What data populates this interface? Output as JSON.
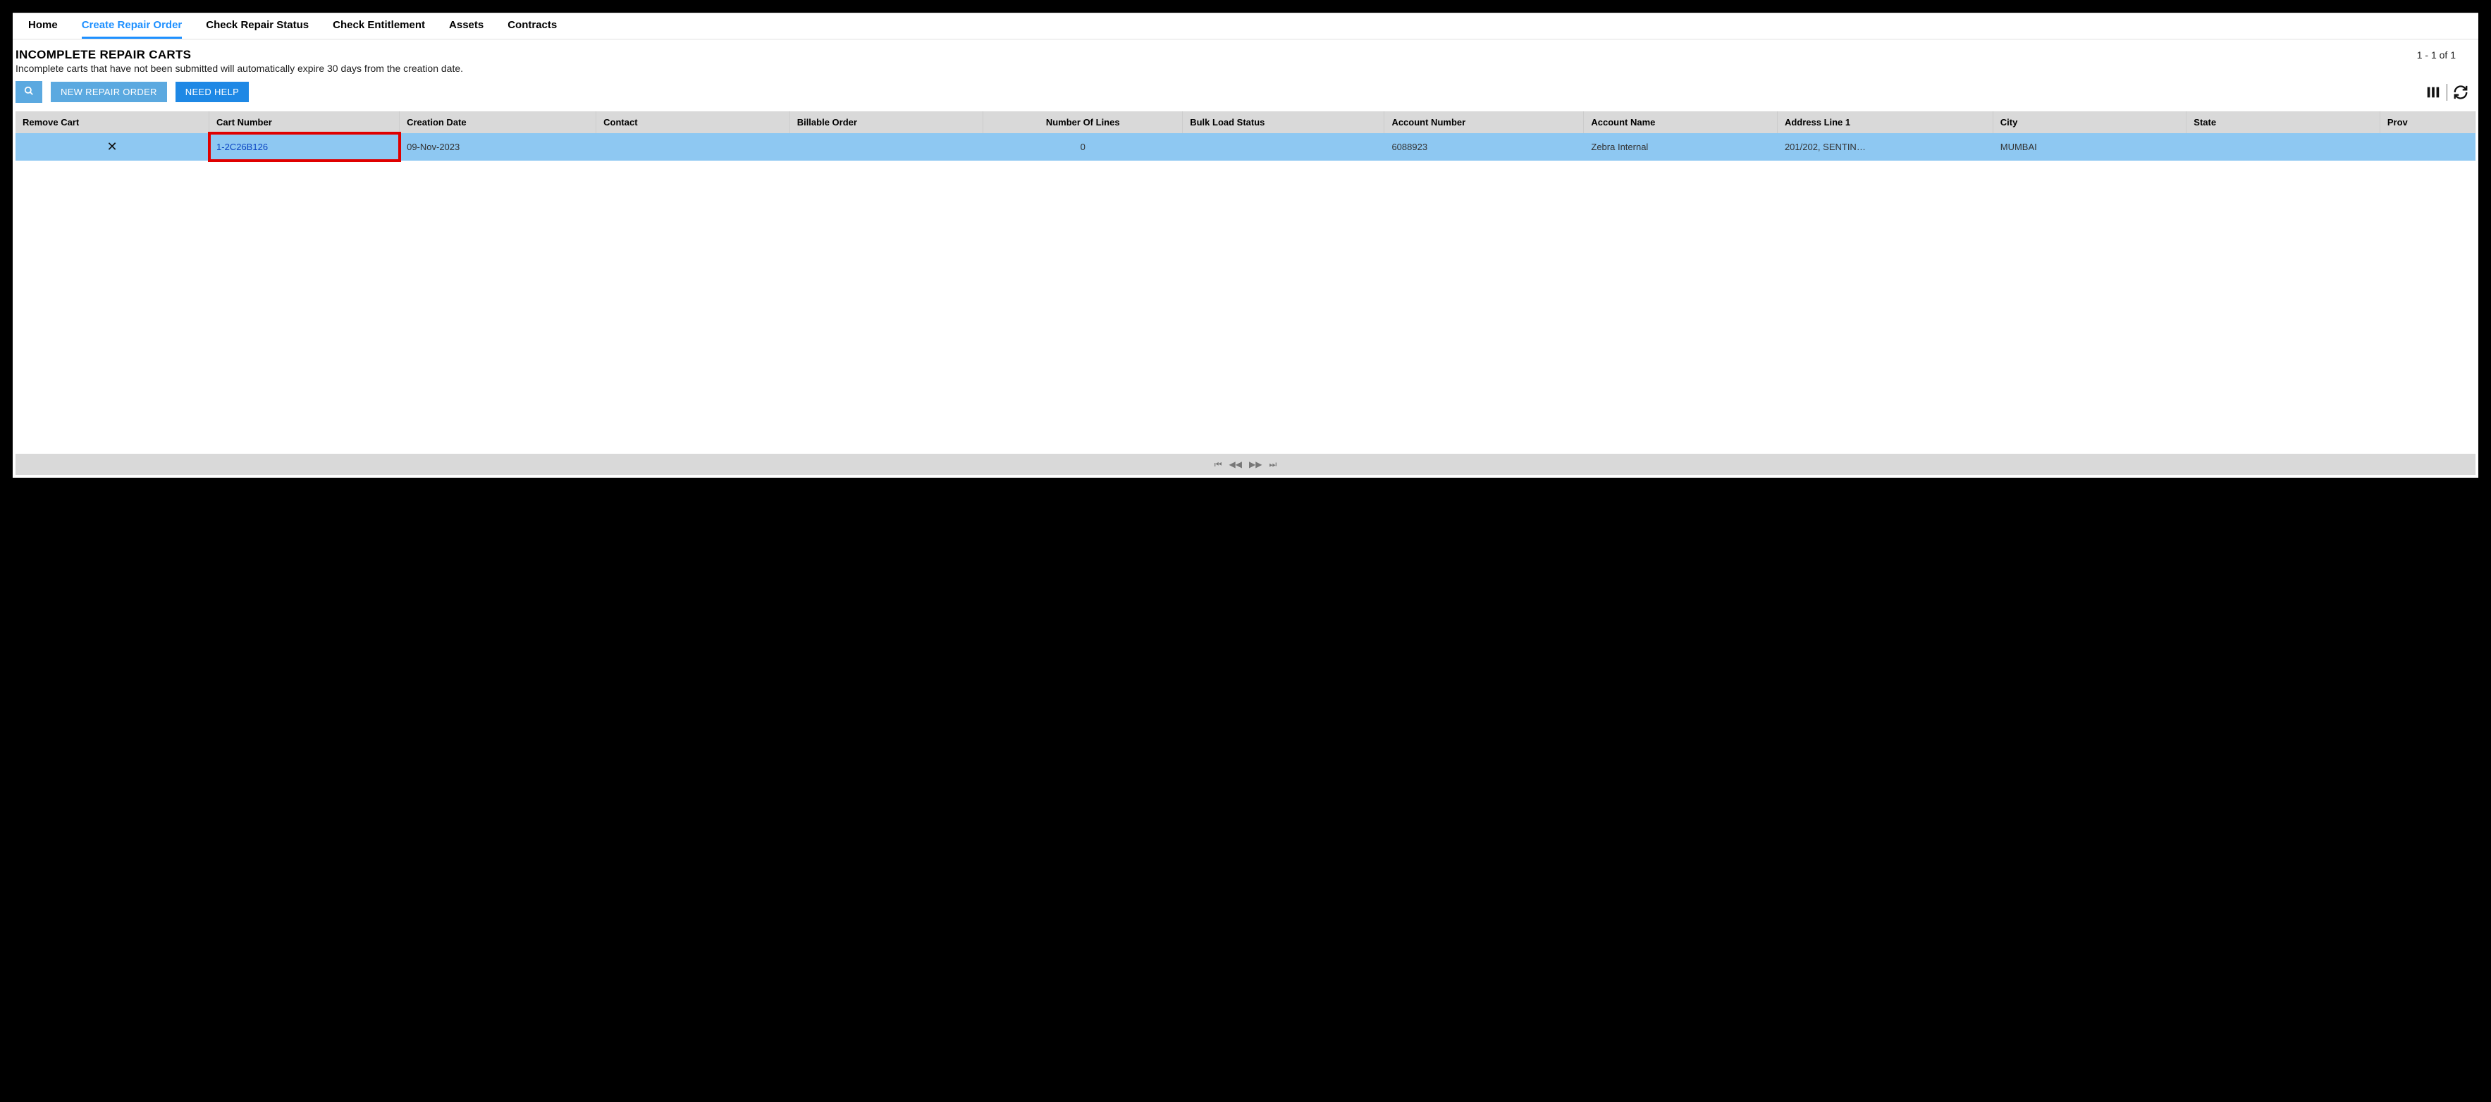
{
  "nav": {
    "items": [
      {
        "label": "Home",
        "active": false
      },
      {
        "label": "Create Repair Order",
        "active": true
      },
      {
        "label": "Check Repair Status",
        "active": false
      },
      {
        "label": "Check Entitlement",
        "active": false
      },
      {
        "label": "Assets",
        "active": false
      },
      {
        "label": "Contracts",
        "active": false
      }
    ]
  },
  "header": {
    "title": "INCOMPLETE REPAIR CARTS",
    "subtitle": "Incomplete carts that have not been submitted will automatically expire 30 days from the creation date.",
    "record_count": "1 - 1 of 1"
  },
  "toolbar": {
    "new_repair_label": "NEW REPAIR ORDER",
    "need_help_label": "NEED HELP"
  },
  "table": {
    "columns": [
      "Remove Cart",
      "Cart Number",
      "Creation Date",
      "Contact",
      "Billable Order",
      "Number Of Lines",
      "Bulk Load Status",
      "Account Number",
      "Account Name",
      "Address Line 1",
      "City",
      "State",
      "Prov"
    ],
    "row": {
      "remove_label_glyph": "✕",
      "cart_number": "1-2C26B126",
      "creation_date": "09-Nov-2023",
      "contact": "",
      "billable_order": "",
      "number_of_lines": "0",
      "bulk_load_status": "",
      "account_number": "6088923",
      "account_name": "Zebra Internal",
      "address_line1": "201/202, SENTIN…",
      "city": "MUMBAI",
      "state": "",
      "province": ""
    }
  }
}
